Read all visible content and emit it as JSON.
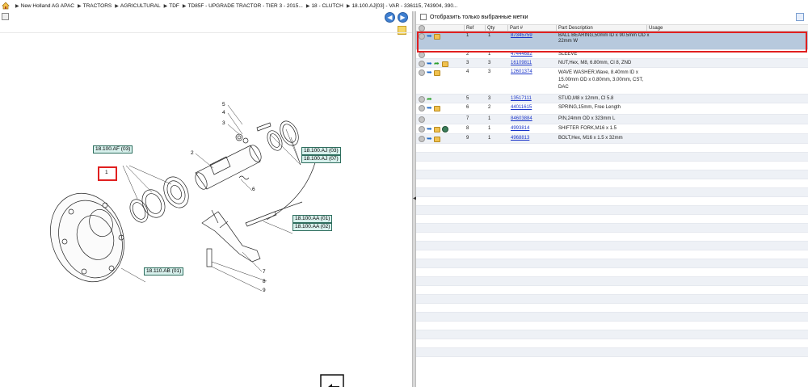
{
  "breadcrumb": {
    "items": [
      "New Holland AG APAC",
      "TRACTORS",
      "AGRICULTURAL",
      "TDF",
      "TD85F - UPGRADE TRACTOR - TIER 3 - 2015...",
      "18 - CLUTCH",
      "18.100.AJ[03] - VAR - 336115, 743904, 390..."
    ]
  },
  "diagram": {
    "callouts": {
      "c1": "18.100.AF (03)",
      "c2": "18.100.AJ (03)",
      "c3": "18.100.AJ (07)",
      "c4": "18.100.AA (01)",
      "c5": "18.100.AA (02)",
      "c6": "18.110.AB (01)"
    },
    "refs": {
      "r1": "1",
      "r2": "2",
      "r3": "3",
      "r4": "4",
      "r5": "5",
      "r6": "6",
      "r7": "7",
      "r8": "8",
      "r9": "9"
    },
    "selected_ref": "1"
  },
  "parts_panel": {
    "filter_label": "Отобразить только выбранные метки",
    "headers": {
      "ref": "Ref",
      "qty": "Qty",
      "part": "Part #",
      "desc": "Part Description",
      "usage": "Usage"
    },
    "rows": [
      {
        "ref": "1",
        "qty": "1",
        "part": "87345759",
        "desc1": "BALL BEARING,50mm ID x 90.5mm OD x",
        "desc2": "22mm W",
        "desc3": "",
        "desc4": "",
        "icons": [
          "info",
          "arrow",
          "box"
        ]
      },
      {
        "ref": "2",
        "qty": "1",
        "part": "47444682",
        "desc1": "SLEEVE",
        "icons": [
          "info"
        ]
      },
      {
        "ref": "3",
        "qty": "3",
        "part": "16109811",
        "desc1": "NUT,Hex, M8, 6.80mm, Cl 8, ZND",
        "icons": [
          "info",
          "arrow",
          "green",
          "box"
        ]
      },
      {
        "ref": "4",
        "qty": "3",
        "part": "12601374",
        "desc1": "WAVE WASHER,Wave, 8.40mm ID x",
        "desc2": "15.00mm OD x 0.80mm, 3.00mm, CST,",
        "desc3": "DAC",
        "icons": [
          "info",
          "arrow",
          "box"
        ]
      },
      {
        "ref": "5",
        "qty": "3",
        "part": "13517111",
        "desc1": "STUD,M8 x 12mm, Cl 5.8",
        "icons": [
          "info",
          "green"
        ]
      },
      {
        "ref": "6",
        "qty": "2",
        "part": "44011615",
        "desc1": "SPRING,15mm, Free Length",
        "icons": [
          "info",
          "arrow",
          "box"
        ]
      },
      {
        "ref": "7",
        "qty": "1",
        "part": "84603884",
        "desc1": "PIN,24mm OD x 323mm L",
        "icons": [
          "info"
        ]
      },
      {
        "ref": "8",
        "qty": "1",
        "part": "4993814",
        "desc1": "SHIFTER FORK,M16 x 1.5",
        "icons": [
          "info",
          "arrow",
          "box",
          "globe"
        ]
      },
      {
        "ref": "9",
        "qty": "1",
        "part": "4968813",
        "desc1": "BOLT,Hex, M16 x 1.5 x 32mm",
        "icons": [
          "info",
          "arrow",
          "box"
        ]
      }
    ]
  },
  "colors": {
    "selected_row": "#b7c9dd",
    "highlight_border": "#e02020",
    "link": "#1a35c9",
    "callout_fill": "#d7f0ec"
  }
}
